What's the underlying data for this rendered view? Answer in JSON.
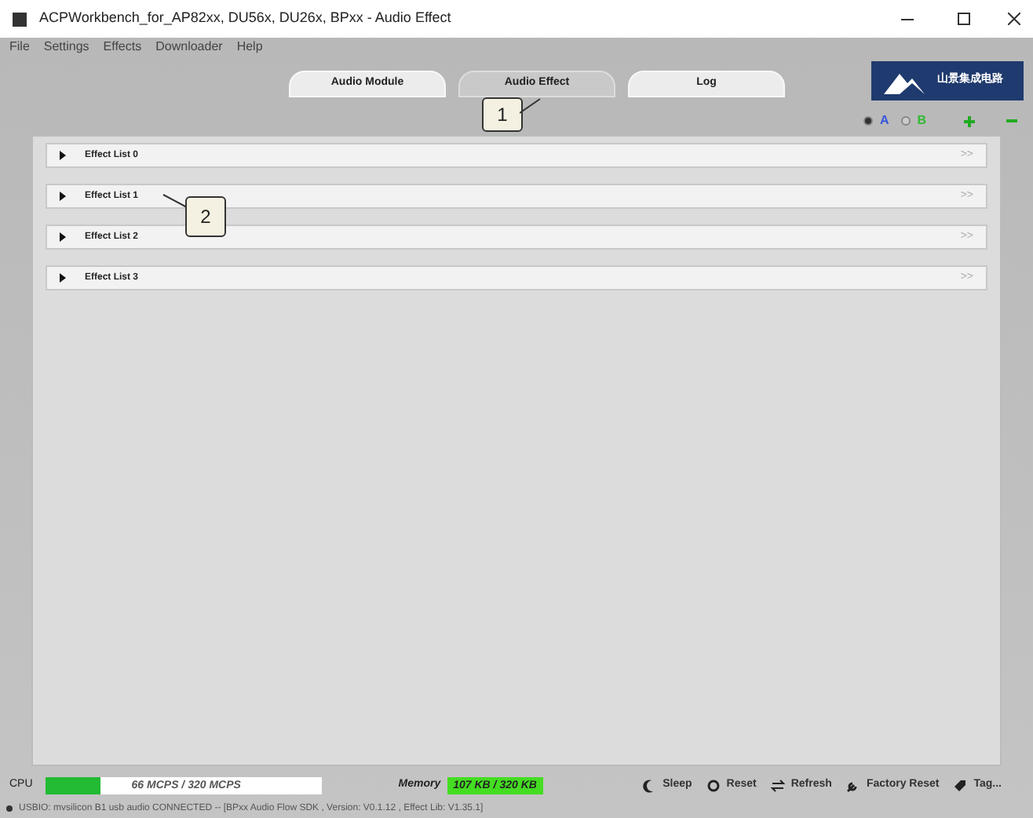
{
  "window": {
    "title": "ACPWorkbench_for_AP82xx, DU56x, DU26x, BPxx - Audio Effect"
  },
  "menu": [
    "File",
    "Settings",
    "Effects",
    "Downloader",
    "Help"
  ],
  "tabs": [
    {
      "label": "Audio Module",
      "selected": false
    },
    {
      "label": "Audio Effect",
      "selected": true
    },
    {
      "label": "Log",
      "selected": false
    }
  ],
  "logo": {
    "text": "山景集成电路"
  },
  "modes": [
    {
      "label": "A",
      "selected": true
    },
    {
      "label": "B",
      "selected": false
    }
  ],
  "effect_lists": [
    {
      "label": "Effect List 0",
      "expanded": false,
      "more": ">>"
    },
    {
      "label": "Effect List 1",
      "expanded": false,
      "more": ">>"
    },
    {
      "label": "Effect List 2",
      "expanded": false,
      "more": ">>"
    },
    {
      "label": "Effect List 3",
      "expanded": false,
      "more": ">>"
    }
  ],
  "callouts": [
    "1",
    "2"
  ],
  "cpu": {
    "label": "CPU",
    "level": 0.2,
    "reading": "66 MCPS / 320 MCPS"
  },
  "memory": {
    "label": "Memory",
    "reading": "107 KB / 320 KB"
  },
  "actions": [
    "Sleep",
    "Reset",
    "Refresh",
    "Factory Reset",
    "Tag..."
  ],
  "status_bar": "USBIO: mvsilicon B1 usb audio CONNECTED -- [BPxx Audio Flow SDK , Version: V0.1.12 , Effect Lib: V1.35.1]"
}
